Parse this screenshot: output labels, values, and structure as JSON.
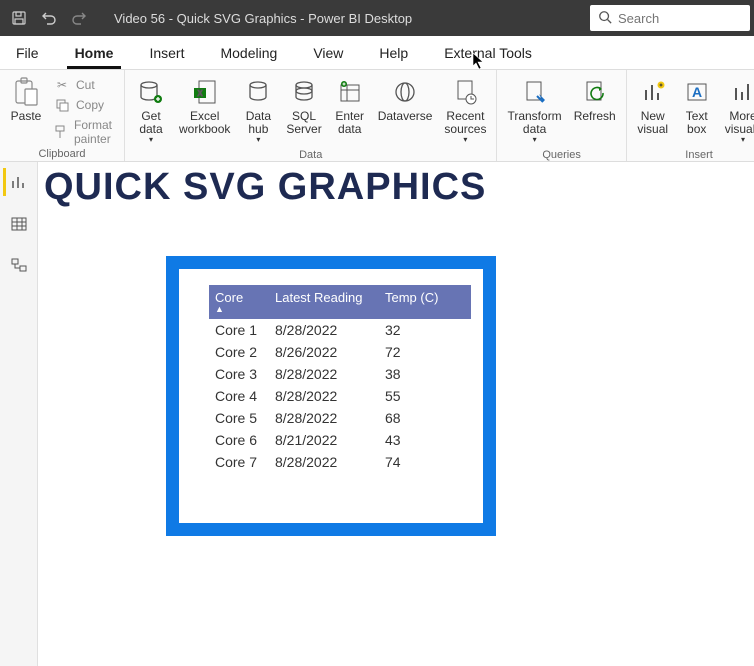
{
  "titlebar": {
    "title": "Video 56 - Quick SVG Graphics - Power BI Desktop",
    "search_placeholder": "Search"
  },
  "menu": {
    "file": "File",
    "home": "Home",
    "insert": "Insert",
    "modeling": "Modeling",
    "view": "View",
    "help": "Help",
    "external_tools": "External Tools"
  },
  "ribbon": {
    "clipboard": {
      "paste": "Paste",
      "cut": "Cut",
      "copy": "Copy",
      "format_painter": "Format painter",
      "group": "Clipboard"
    },
    "data": {
      "get_data": "Get\ndata",
      "excel": "Excel\nworkbook",
      "data_hub": "Data\nhub",
      "sql": "SQL\nServer",
      "enter": "Enter\ndata",
      "dataverse": "Dataverse",
      "recent": "Recent\nsources",
      "group": "Data"
    },
    "queries": {
      "transform": "Transform\ndata",
      "refresh": "Refresh",
      "group": "Queries"
    },
    "insert": {
      "new_visual": "New\nvisual",
      "text_box": "Text\nbox",
      "more_visuals": "More\nvisuals",
      "group": "Insert"
    }
  },
  "canvas": {
    "title": "QUICK SVG GRAPHICS"
  },
  "chart_data": {
    "type": "table",
    "columns": [
      "Core",
      "Latest Reading",
      "Temp (C)"
    ],
    "sort_column": "Core",
    "sort_dir": "asc",
    "rows": [
      {
        "core": "Core 1",
        "date": "8/28/2022",
        "temp": 32
      },
      {
        "core": "Core 2",
        "date": "8/26/2022",
        "temp": 72
      },
      {
        "core": "Core 3",
        "date": "8/28/2022",
        "temp": 38
      },
      {
        "core": "Core 4",
        "date": "8/28/2022",
        "temp": 55
      },
      {
        "core": "Core 5",
        "date": "8/28/2022",
        "temp": 68
      },
      {
        "core": "Core 6",
        "date": "8/21/2022",
        "temp": 43
      },
      {
        "core": "Core 7",
        "date": "8/28/2022",
        "temp": 74
      }
    ]
  }
}
